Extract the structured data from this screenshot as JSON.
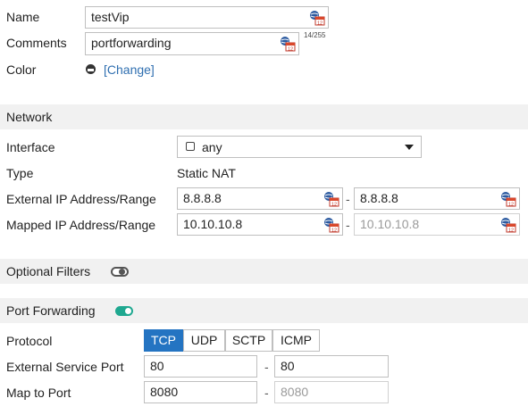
{
  "form": {
    "name_label": "Name",
    "name_value": "testVip",
    "comments_label": "Comments",
    "comments_value": "portforwarding",
    "comments_counter": "14/255",
    "color_label": "Color",
    "color_change": "[Change]"
  },
  "network": {
    "section_title": "Network",
    "interface_label": "Interface",
    "interface_value": "any",
    "type_label": "Type",
    "type_value": "Static NAT",
    "external_ip_label": "External IP Address/Range",
    "external_ip_start": "8.8.8.8",
    "external_ip_end": "8.8.8.8",
    "mapped_ip_label": "Mapped IP Address/Range",
    "mapped_ip_start": "10.10.10.8",
    "mapped_ip_end": "10.10.10.8",
    "range_separator": "-"
  },
  "optional_filters": {
    "section_title": "Optional Filters",
    "enabled": false
  },
  "port_forwarding": {
    "section_title": "Port Forwarding",
    "enabled": true,
    "protocol_label": "Protocol",
    "protocols": [
      "TCP",
      "UDP",
      "SCTP",
      "ICMP"
    ],
    "selected_protocol": "TCP",
    "external_port_label": "External Service Port",
    "external_port_start": "80",
    "external_port_end": "80",
    "map_port_label": "Map to Port",
    "map_port_start": "8080",
    "map_port_end": "8080",
    "range_separator": "-"
  },
  "colors": {
    "accent": "#2474c2",
    "toggle_on": "#1fa890",
    "section_bg": "#f1f1f1",
    "link": "#2f6fb0"
  },
  "icons": {
    "field_icon": "calendar-globe-icon",
    "color_icon": "color-swatch-icon"
  }
}
